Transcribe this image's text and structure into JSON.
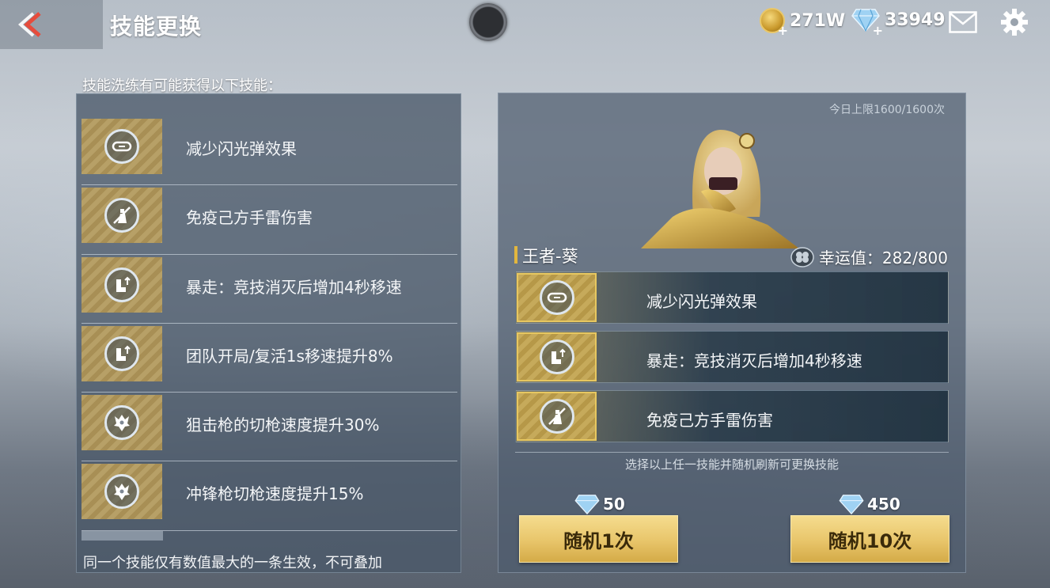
{
  "header": {
    "title": "技能更换",
    "gold": "271W",
    "gems": "33949"
  },
  "left_panel": {
    "heading": "技能洗练有可能获得以下技能：",
    "skills": [
      {
        "label": "减少闪光弹效果",
        "icon": "goggles-icon"
      },
      {
        "label": "免疫己方手雷伤害",
        "icon": "no-grenade-icon"
      },
      {
        "label": "暴走：竞技消灭后增加4秒移速",
        "icon": "boot-speed-icon"
      },
      {
        "label": "团队开局/复活1s移速提升8%",
        "icon": "boot-speed-icon"
      },
      {
        "label": "狙击枪的切枪速度提升30%",
        "icon": "wolf-emblem-icon"
      },
      {
        "label": "冲锋枪切枪速度提升15%",
        "icon": "wolf-emblem-icon"
      }
    ],
    "note": "同一个技能仅有数值最大的一条生效，不可叠加"
  },
  "right_panel": {
    "daily_limit": "今日上限1600/1600次",
    "character_name": "王者-葵",
    "luck": "幸运值：282/800",
    "selected_skills": [
      {
        "label": "减少闪光弹效果",
        "icon": "goggles-icon"
      },
      {
        "label": "暴走：竞技消灭后增加4秒移速",
        "icon": "boot-speed-icon"
      },
      {
        "label": "免疫己方手雷伤害",
        "icon": "no-grenade-icon"
      }
    ],
    "hint": "选择以上任一技能并随机刷新可更换技能",
    "roll_once": {
      "label": "随机1次",
      "cost": "50"
    },
    "roll_ten": {
      "label": "随机10次",
      "cost": "450"
    }
  },
  "colors": {
    "accent_gold": "#e8c56a",
    "panel_bg": "#4a5869",
    "text_white": "#ffffff"
  }
}
